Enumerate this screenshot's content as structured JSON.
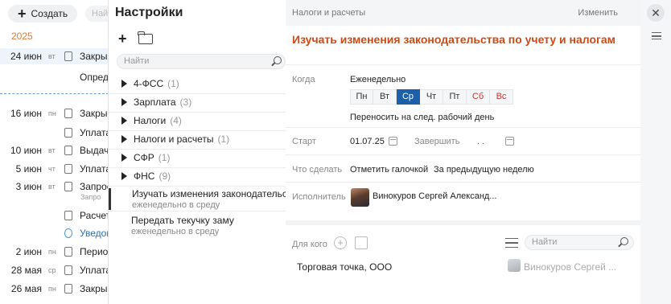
{
  "calendar": {
    "create_label": "Создать",
    "search_ghost": "Най",
    "year": "2025",
    "rows": [
      {
        "date": "24 июн",
        "dow": "вт",
        "text": "Закры"
      },
      {
        "date": "",
        "dow": "",
        "text": "Опред"
      },
      {
        "date": "16 июн",
        "dow": "пн",
        "text": "Закры"
      },
      {
        "date": "",
        "dow": "",
        "text": "Уплата"
      },
      {
        "date": "10 июн",
        "dow": "вт",
        "text": "Выдач"
      },
      {
        "date": "5 июн",
        "dow": "чт",
        "text": "Уплата"
      },
      {
        "date": "3 июн",
        "dow": "вт",
        "text": "Запрос"
      },
      {
        "date": "",
        "dow": "",
        "text": "Запро"
      },
      {
        "date": "",
        "dow": "",
        "text": "Расчет"
      },
      {
        "date": "",
        "dow": "",
        "text": "Уведом"
      },
      {
        "date": "2 июн",
        "dow": "пн",
        "text": "Перио,"
      },
      {
        "date": "28 мая",
        "dow": "ср",
        "text": "Уплата"
      },
      {
        "date": "26 мая",
        "dow": "пн",
        "text": "Закры"
      }
    ]
  },
  "settings": {
    "title": "Настройки",
    "search_placeholder": "Найти",
    "folders": [
      {
        "name": "4-ФСС",
        "count": "(1)"
      },
      {
        "name": "Зарплата",
        "count": "(3)"
      },
      {
        "name": "Налоги",
        "count": "(4)"
      },
      {
        "name": "Налоги и расчеты",
        "count": "(1)"
      },
      {
        "name": "СФР",
        "count": "(1)"
      },
      {
        "name": "ФНС",
        "count": "(9)"
      }
    ],
    "tasks": [
      {
        "title": "Изучать изменения законодательства",
        "sub": "еженедельно в среду"
      },
      {
        "title": "Передать текучку заму",
        "sub": "еженедельно в среду"
      }
    ]
  },
  "detail": {
    "breadcrumb": "Налоги и расчеты",
    "edit_label": "Изменить",
    "title": "Изучать изменения законодательства по учету и налогам",
    "when_label": "Когда",
    "when_value": "Еженедельно",
    "days": [
      "Пн",
      "Вт",
      "Ср",
      "Чт",
      "Пт",
      "Сб",
      "Вс"
    ],
    "selected_day": "Ср",
    "carry_over": "Переносить на след. рабочий день",
    "start_label": "Старт",
    "start_value": "01.07.25",
    "finish_label": "Завершить",
    "finish_value": ". .",
    "action_label": "Что сделать",
    "action_value": "Отметить галочкой",
    "action_period": "За предыдущую неделю",
    "assignee_label": "Исполнитель",
    "assignee_name": "Винокуров Сергей Александ...",
    "for_who_label": "Для кого",
    "search2_placeholder": "Найти",
    "org_name": "Торговая точка, ООО",
    "org_person": "Винокуров Сергей ..."
  },
  "colors": {
    "accent_title": "#cc4a14",
    "selected_day": "#1d5fa8",
    "weekend": "#cc3333",
    "year": "#e07b3a"
  }
}
